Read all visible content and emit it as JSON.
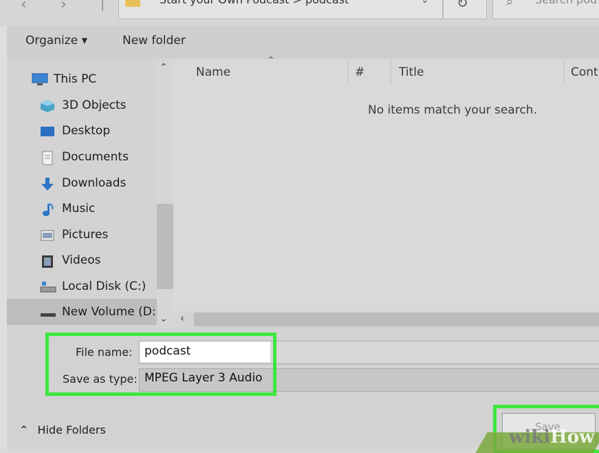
{
  "address_bar": {
    "back_icon": "back-arrow-icon",
    "forward_icon": "forward-arrow-icon",
    "path_text": "Start your Own Podcast  >  podcast",
    "search_placeholder": "Search pod"
  },
  "toolbar": {
    "organize_label": "Organize ▾",
    "new_folder_label": "New folder"
  },
  "nav": {
    "items": [
      {
        "label": "This PC",
        "icon": "this-pc-icon"
      },
      {
        "label": "3D Objects",
        "icon": "3d-objects-icon"
      },
      {
        "label": "Desktop",
        "icon": "desktop-icon"
      },
      {
        "label": "Documents",
        "icon": "documents-icon"
      },
      {
        "label": "Downloads",
        "icon": "downloads-icon"
      },
      {
        "label": "Music",
        "icon": "music-icon"
      },
      {
        "label": "Pictures",
        "icon": "pictures-icon"
      },
      {
        "label": "Videos",
        "icon": "videos-icon"
      },
      {
        "label": "Local Disk (C:)",
        "icon": "local-disk-icon"
      },
      {
        "label": "New Volume (D:",
        "icon": "drive-icon",
        "selected": true
      }
    ]
  },
  "columns": {
    "name": "Name",
    "number": "#",
    "title": "Title",
    "contributing": "Cont"
  },
  "content": {
    "empty_message": "No items match your search."
  },
  "form": {
    "file_name_label": "File name:",
    "file_name_value": "podcast",
    "save_as_type_label": "Save as type:",
    "save_as_type_value": "MPEG Layer 3 Audio"
  },
  "footer": {
    "hide_folders_label": "Hide Folders",
    "save_label": "Save"
  },
  "watermark": {
    "wiki": "wiki",
    "how": "How"
  },
  "colors": {
    "highlight": "#3ee63e",
    "background": "#d9d9d9"
  }
}
